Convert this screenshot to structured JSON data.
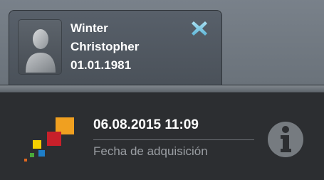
{
  "patient": {
    "last_name": "Winter",
    "first_name": "Christopher",
    "birth_date": "01.01.1981"
  },
  "acquisition": {
    "datetime": "06.08.2015 11:09",
    "label": "Fecha de adquisición"
  },
  "icons": {
    "avatar": "person-silhouette-icon",
    "close": "close-x-icon",
    "logo": "colored-squares-logo",
    "info": "info-icon"
  },
  "colors": {
    "close_icon": "#7fc9e6",
    "logo_orange": "#f0a020",
    "logo_red": "#c8202a",
    "logo_yellow": "#f4d000",
    "logo_blue": "#1e7ec8",
    "logo_green": "#4aa83a"
  }
}
